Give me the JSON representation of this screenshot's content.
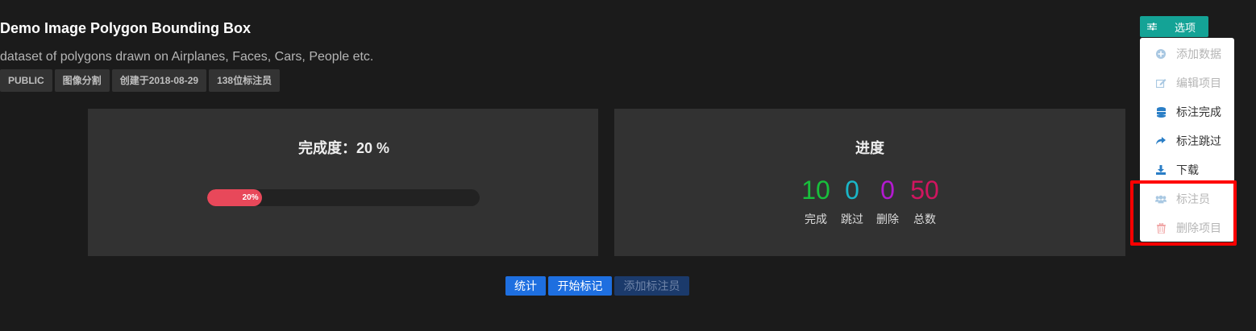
{
  "project": {
    "title": "Demo Image Polygon Bounding Box",
    "description": "dataset of polygons drawn on Airplanes, Faces, Cars, People etc.",
    "tags": [
      "PUBLIC",
      "图像分割",
      "创建于2018-08-29",
      "138位标注员"
    ]
  },
  "completion": {
    "title": "完成度：20 %",
    "percent": 20,
    "bar_label": "20%",
    "bar_color": "#e8485a"
  },
  "progress": {
    "title": "进度",
    "stats": [
      {
        "value": "10",
        "label": "完成",
        "color": "#18c03c"
      },
      {
        "value": "0",
        "label": "跳过",
        "color": "#1ab6c8"
      },
      {
        "value": "0",
        "label": "删除",
        "color": "#b31ad0"
      },
      {
        "value": "50",
        "label": "总数",
        "color": "#d0155f"
      }
    ]
  },
  "actions": {
    "stats_label": "统计",
    "start_label": "开始标记",
    "add_annotator_label": "添加标注员"
  },
  "options": {
    "label": "选项",
    "icon": "sliders-icon",
    "menu": [
      {
        "label": "添加数据",
        "icon": "plus-circle-icon",
        "enabled": false,
        "icon_color": "#a9c8e2"
      },
      {
        "label": "编辑项目",
        "icon": "edit-icon",
        "enabled": false,
        "icon_color": "#a9c8e2"
      },
      {
        "label": "标注完成",
        "icon": "database-icon",
        "enabled": true,
        "icon_color": "#2a7ec6"
      },
      {
        "label": "标注跳过",
        "icon": "share-arrow-icon",
        "enabled": true,
        "icon_color": "#2a7ec6"
      },
      {
        "label": "下载",
        "icon": "download-icon",
        "enabled": true,
        "icon_color": "#2a7ec6"
      },
      {
        "label": "标注员",
        "icon": "users-icon",
        "enabled": false,
        "icon_color": "#a9c8e2"
      },
      {
        "label": "删除项目",
        "icon": "trash-icon",
        "enabled": false,
        "icon_color": "#f0a6a6"
      }
    ]
  },
  "colors": {
    "accent": "#14a396",
    "primary_button": "#1e6fe0",
    "highlight_border": "#ff0000"
  }
}
